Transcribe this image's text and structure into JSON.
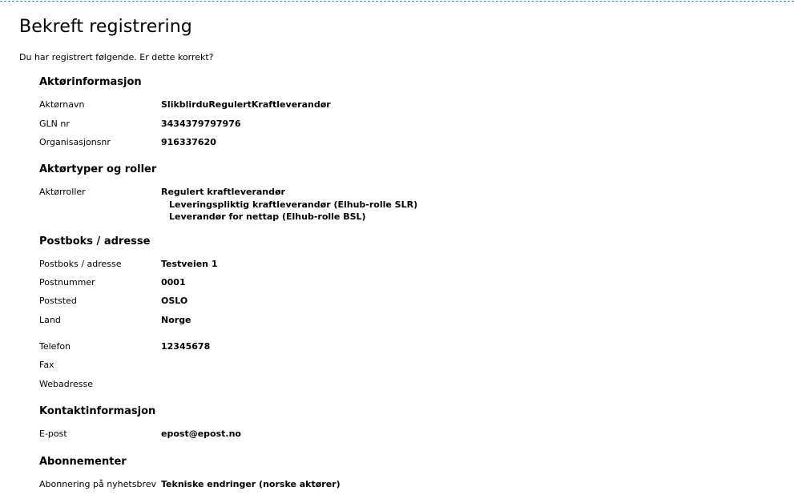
{
  "page": {
    "title": "Bekreft registrering",
    "intro": "Du har registrert følgende. Er dette korrekt?"
  },
  "aktor": {
    "heading": "Aktørinformasjon",
    "rows": [
      {
        "label": "Aktørnavn",
        "value": "SlikblirduRegulertKraftleverandør"
      },
      {
        "label": "GLN nr",
        "value": "3434379797976"
      },
      {
        "label": "Organisasjonsnr",
        "value": "916337620"
      }
    ]
  },
  "roller": {
    "heading": "Aktørtyper og roller",
    "label": "Aktørroller",
    "main_role": "Regulert kraftleverandør",
    "sub_roles": [
      "Leveringspliktig kraftleverandør (Elhub-rolle SLR)",
      "Leverandør for nettap (Elhub-rolle BSL)"
    ]
  },
  "adresse": {
    "heading": "Postboks / adresse",
    "rows": [
      {
        "label": "Postboks / adresse",
        "value": "Testveien 1"
      },
      {
        "label": "Postnummer",
        "value": "0001"
      },
      {
        "label": "Poststed",
        "value": "OSLO"
      },
      {
        "label": "Land",
        "value": "Norge"
      },
      {
        "label": "Telefon",
        "value": "12345678"
      },
      {
        "label": "Fax",
        "value": ""
      },
      {
        "label": "Webadresse",
        "value": ""
      }
    ]
  },
  "kontakt": {
    "heading": "Kontaktinformasjon",
    "rows": [
      {
        "label": "E-post",
        "value": "epost@epost.no"
      }
    ]
  },
  "abonnement": {
    "heading": "Abonnementer",
    "rows": [
      {
        "label": "Abonnering på nyhetsbrev",
        "value": "Tekniske endringer (norske aktører)"
      }
    ]
  }
}
